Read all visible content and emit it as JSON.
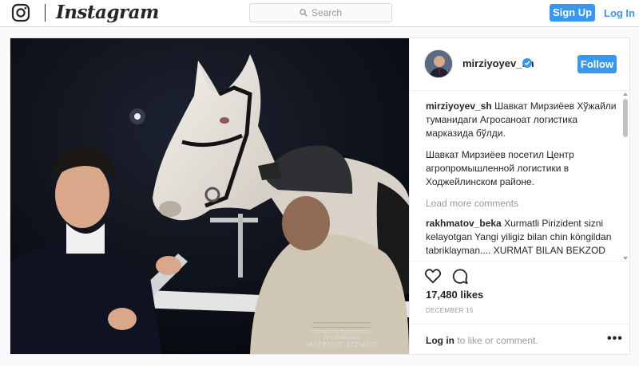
{
  "header": {
    "logo_text": "Instagram",
    "search_placeholder": "Search",
    "signup_label": "Sign Up",
    "login_label": "Log In"
  },
  "post": {
    "username": "mirziyoyev_sh",
    "verified": true,
    "follow_label": "Follow",
    "watermark": {
      "line1": "Ozbekiston Respublikasi Prezidentining",
      "line2": "MATBUOT XIZMATI"
    },
    "comments": [
      {
        "user": "mirziyoyev_sh",
        "text": "Шавкат Мирзиёев Хўжайли туманидаги Агросаноат логистика марказида бўлди."
      },
      {
        "user": "",
        "text": "Шавкат Мирзиёев посетил Центр агропромышленной логистики в Ходжейлинском районе."
      }
    ],
    "load_more_label": "Load more comments",
    "reply": {
      "user": "rakhmatov_beka",
      "text": "Xurmatli Pirizident sizni kelayotgan Yangi yiligiz bilan chin köngildan tabriklayman.... XURMAT BILAN BEKZOD RAXMATOV"
    },
    "likes": "17,480 likes",
    "date": "DECEMBER 15",
    "login_prompt_link": "Log in",
    "login_prompt_rest": " to like or comment.",
    "more_options_label": "•••"
  },
  "colors": {
    "accent": "#3897f0",
    "text": "#262626",
    "muted": "#999999",
    "border": "#dbdbdb"
  },
  "icons": [
    "instagram-glyph-icon",
    "search-icon",
    "verified-badge-icon",
    "heart-icon",
    "comment-icon",
    "more-options-icon"
  ]
}
